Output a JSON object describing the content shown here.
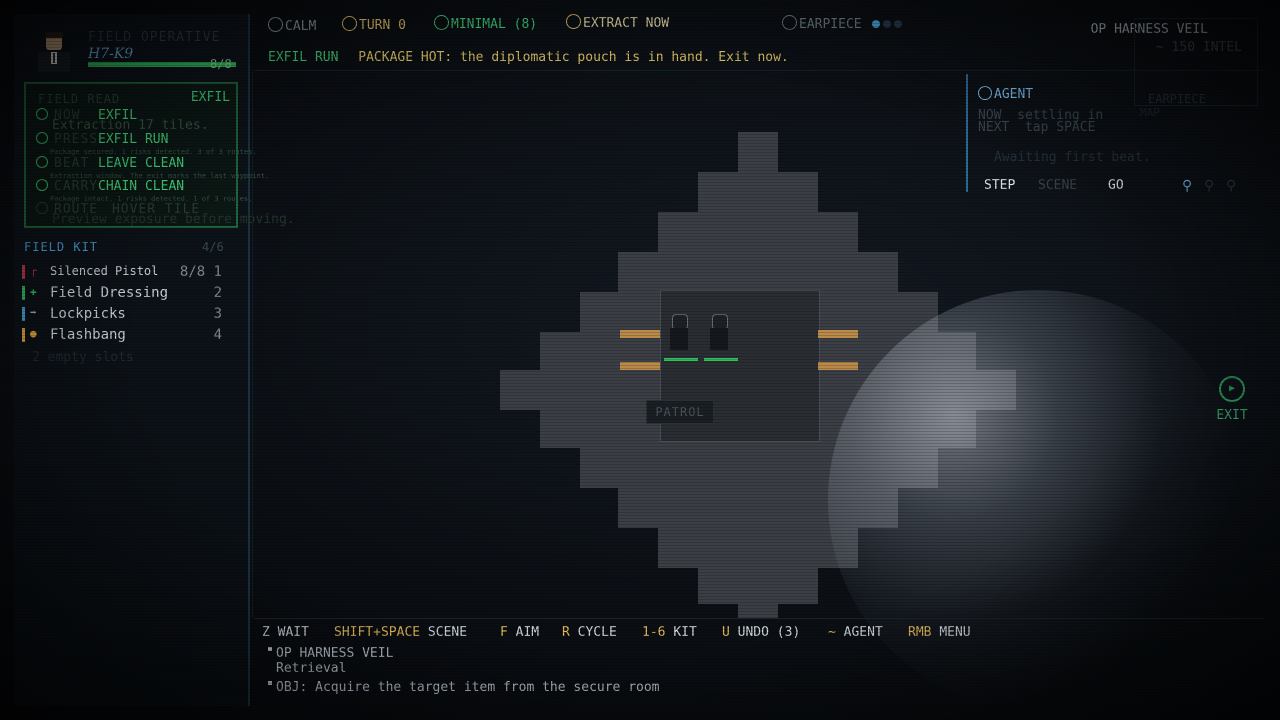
{
  "operative": {
    "label": "FIELD OPERATIVE",
    "name": "H7-K9",
    "hp": "8/8",
    "hp_fraction": 1.0
  },
  "field_read": {
    "title": "FIELD READ",
    "mode": "EXFIL",
    "rows": [
      {
        "key": "NOW",
        "value": "EXFIL",
        "sub": "Extraction 17 tiles."
      },
      {
        "key": "PRESS",
        "value": "EXFIL RUN",
        "sub": "Package secured. 1 risks detected. 3 of 3 routes."
      },
      {
        "key": "BEAT",
        "value": "LEAVE CLEAN",
        "sub": "Extraction window. The exit marks the last waypoint."
      },
      {
        "key": "CARRY",
        "value": "CHAIN CLEAN",
        "sub": "Package intact. 1 risks detected. 1 of 3 routes."
      },
      {
        "key": "ROUTE",
        "value": "HOVER TILE",
        "sub": "Preview exposure before moving."
      }
    ]
  },
  "kit": {
    "title": "FIELD KIT",
    "count": "4/6",
    "items": [
      {
        "name": "Silenced Pistol",
        "qty": "8/8 1",
        "color": "#c0394b",
        "icon": "pistol-icon"
      },
      {
        "name": "Field Dressing",
        "qty": "2",
        "color": "#2fbf5f",
        "icon": "medkit-icon"
      },
      {
        "name": "Lockpicks",
        "qty": "3",
        "color": "#4aa3d6",
        "icon": "lockpick-icon"
      },
      {
        "name": "Flashbang",
        "qty": "4",
        "color": "#e2a440",
        "icon": "flashbang-icon"
      }
    ],
    "empty": "2 empty slots"
  },
  "topbar": {
    "calm": "CALM",
    "turn": "TURN 0",
    "minimal": "MINIMAL (8)",
    "extract": "EXTRACT NOW",
    "earpiece": "EARPIECE",
    "op_name": "OP HARNESS VEIL",
    "intel": "~ 150 INTEL",
    "earpiece_ghost": "EARPIECE",
    "map_ghost": "MAP"
  },
  "status": {
    "tag": "EXFIL RUN",
    "message": "PACKAGE HOT: the diplomatic pouch is in hand. Exit now."
  },
  "agent": {
    "title": "AGENT",
    "now_label": "NOW",
    "now_text": "settling in",
    "next_label": "NEXT",
    "next_text": "tap SPACE",
    "awaiting": "Awaiting first beat.",
    "step": "STEP",
    "scene": "SCENE",
    "go": "GO"
  },
  "map": {
    "patrol_label": "PATROL",
    "exit_label": "EXIT"
  },
  "hints": [
    {
      "key": "Z",
      "value": "WAIT"
    },
    {
      "key": "SHIFT+SPACE",
      "value": "SCENE"
    },
    {
      "key": "F",
      "value": "AIM"
    },
    {
      "key": "R",
      "value": "CYCLE"
    },
    {
      "key": "1-6",
      "value": "KIT"
    },
    {
      "key": "U",
      "value": "UNDO (3)"
    },
    {
      "key": "~",
      "value": "AGENT"
    },
    {
      "key": "RMB",
      "value": "MENU"
    }
  ],
  "log": {
    "line1": "OP HARNESS VEIL",
    "line2": "Retrieval",
    "line3": "OBJ: Acquire the target item from the secure room"
  },
  "colors": {
    "accent_green": "#3fcf7a",
    "accent_blue": "#4aa3d6",
    "accent_gold": "#e2c66a"
  }
}
